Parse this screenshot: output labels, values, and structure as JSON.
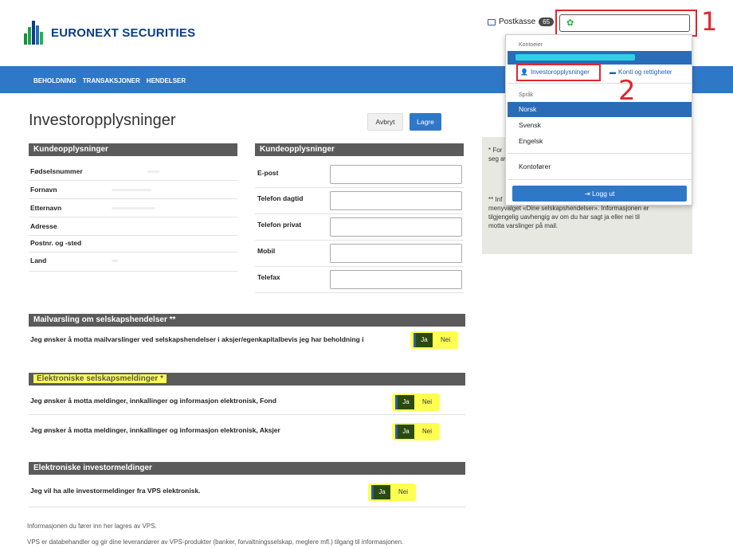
{
  "brand": {
    "name": "EURONEXT SECURITIES"
  },
  "header": {
    "mailbox_label": "Postkasse",
    "mailbox_count": "65"
  },
  "nav": {
    "items": [
      "BEHOLDNING",
      "TRANSAKSJONER",
      "HENDELSER"
    ]
  },
  "annotations": {
    "one": "1",
    "two": "2"
  },
  "dropdown": {
    "section_account_holder": "Kontoeier",
    "investor_info": "Investoropplysninger",
    "accounts_rights": "Konti og rettigheter",
    "section_language": "Språk",
    "languages": [
      "Norsk",
      "Svensk",
      "Engelsk"
    ],
    "active_language": "Norsk",
    "account_operator": "Kontofører",
    "logout": "Logg ut"
  },
  "page": {
    "title": "Investoropplysninger",
    "cancel": "Avbryt",
    "save": "Lagre"
  },
  "customer_left": {
    "heading": "Kundeopplysninger",
    "fields": [
      "Fødselsnummer",
      "Fornavn",
      "Etternavn",
      "Adresse",
      "Postnr. og -sted",
      "Land"
    ]
  },
  "customer_right": {
    "heading": "Kundeopplysninger",
    "fields": [
      "E-post",
      "Telefon dagtid",
      "Telefon privat",
      "Mobil",
      "Telefax"
    ]
  },
  "side": {
    "note1": "* For",
    "note1b": "seg av",
    "note2": "** Inf",
    "note2_lines": [
      "menyvalget «Dine selskapshendelser». Informasjonen er",
      "tilgjengelig uavhengig av om du har sagt ja eller nei til",
      "motta varslinger på mail."
    ]
  },
  "mail_section": {
    "heading": "Mailvarsling om selskapshendelser **",
    "question": "Jeg ønsker å motta mailvarslinger ved selskapshendelser i aksjer/egenkapitalbevis jeg har beholdning i"
  },
  "electronic_section": {
    "heading": "Elektroniske selskapsmeldinger *",
    "q1": "Jeg ønsker å motta meldinger, innkallinger og informasjon elektronisk, Fond",
    "q2": "Jeg ønsker å motta meldinger, innkallinger og informasjon elektronisk, Aksjer"
  },
  "investor_section": {
    "heading": "Elektroniske investormeldinger",
    "question": "Jeg vil ha alle investormeldinger fra VPS elektronisk."
  },
  "toggle": {
    "yes": "Ja",
    "no": "Nei"
  },
  "footer": {
    "line1": "Informasjonen du fører inn her lagres av VPS.",
    "line2": "VPS er databehandler og gir dine leverandører av VPS-produkter (banker, forvaltningsselskap, meglere mfl.) tilgang til informasjonen."
  },
  "colors": {
    "nav": "#2f78c7",
    "brand": "#0a3d8a",
    "annotation": "#e0262e",
    "highlight": "#ffff52",
    "section": "#5b5b5b"
  },
  "icons": [
    "mailbox-icon",
    "gear-icon",
    "user-icon",
    "briefcase-icon",
    "logout-icon"
  ]
}
